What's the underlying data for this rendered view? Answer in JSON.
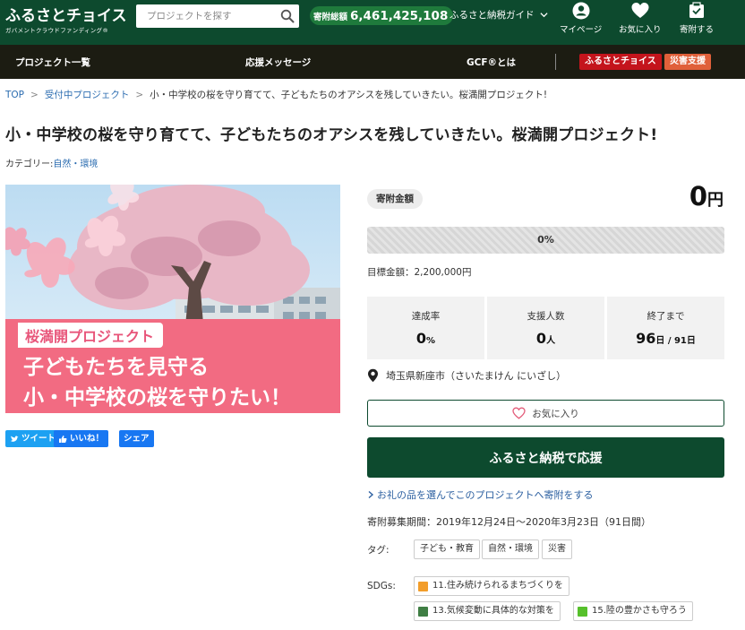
{
  "header": {
    "logo": "ふるさとチョイス",
    "logo_sub": "ガバメントクラウドファンディング®",
    "search_placeholder": "プロジェクトを探す",
    "total_label": "寄附総額",
    "total_value": "6,461,425,108",
    "guide_label": "ふるさと納税ガイド",
    "mypage_label": "マイページ",
    "favorites_label": "お気に入り",
    "donate_label": "寄附する",
    "colors": {
      "bg": "#0d4a2e",
      "accent": "#1f7a3c"
    }
  },
  "nav": {
    "items": [
      "プロジェクト一覧",
      "応援メッセージ",
      "GCF®とは"
    ],
    "badge_furusato": "ふるさとチョイス",
    "badge_disaster": "災害支援",
    "badge_colors": {
      "furusato": "#c4141c",
      "disaster": "#e0603a"
    }
  },
  "breadcrumb": {
    "items": [
      "TOP",
      "受付中プロジェクト",
      "小・中学校の桜を守り育てて、子どもたちのオアシスを残していきたい。桜満開プロジェクト!"
    ],
    "separator": ">"
  },
  "project": {
    "title": "小・中学校の桜を守り育てて、子どもたちのオアシスを残していきたい。桜満開プロジェクト!",
    "category_label": "カテゴリー:",
    "category": "自然・環境"
  },
  "hero": {
    "tag": "桜満開プロジェクト",
    "line1": "子どもたちを見守る",
    "line2": "小・中学校の桜を守りたい！"
  },
  "sns": {
    "tweet": "ツイート",
    "like": "いいね！",
    "share": "シェア"
  },
  "funding": {
    "amount_label": "寄附金額",
    "amount": "0",
    "amount_unit": "円",
    "progress_percent": 0,
    "progress_label": "0%",
    "goal": "目標金額：2,200,000円",
    "stats": {
      "rate_label": "達成率",
      "rate_value": "0",
      "rate_unit": "%",
      "supporters_label": "支援人数",
      "supporters_value": "0",
      "supporters_unit": "人",
      "remaining_label": "終了まで",
      "remaining_value": "96",
      "remaining_unit": "日 / 91日"
    },
    "location": "埼玉県新座市（さいたまけん にいざし）",
    "favorite_button": "お気に入り",
    "donate_button": "ふるさと納税で応援",
    "gift_link": "お礼の品を選んでこのプロジェクトへ寄附をする",
    "period": "寄附募集期間：2019年12月24日〜2020年3月23日（91日間）"
  },
  "tags": {
    "label": "タグ:",
    "items": [
      "子ども・教育",
      "自然・環境",
      "災害"
    ]
  },
  "sdgs": {
    "label": "SDGs:",
    "items": [
      {
        "label": "11.住み続けられるまちづくりを",
        "color": "#f29d2a"
      },
      {
        "label": "13.気候変動に具体的な対策を",
        "color": "#3f7e44"
      },
      {
        "label": "15.陸の豊かさも守ろう",
        "color": "#56c02b"
      }
    ]
  }
}
